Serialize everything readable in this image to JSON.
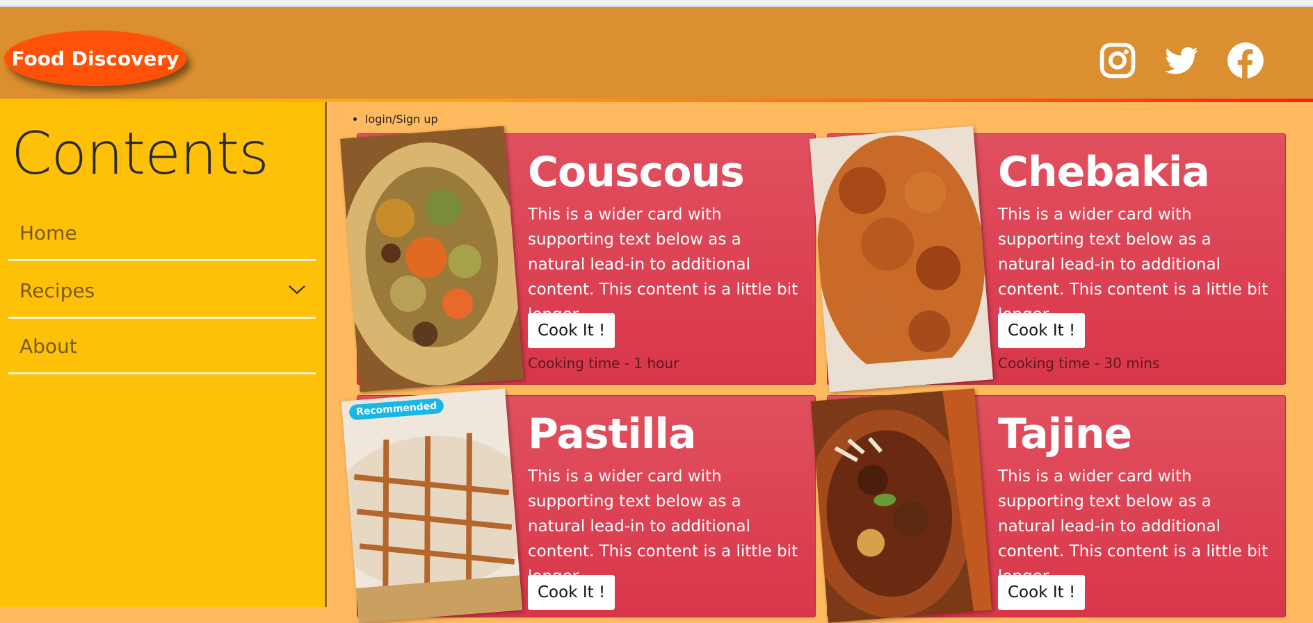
{
  "header": {
    "brand": "Food Discovery",
    "social": [
      "instagram-icon",
      "twitter-icon",
      "facebook-icon"
    ]
  },
  "sidebar": {
    "title": "Contents",
    "items": [
      {
        "label": "Home"
      },
      {
        "label": "Recipes",
        "has_dropdown": true
      },
      {
        "label": "About"
      }
    ]
  },
  "nav": {
    "login": "login/Sign up"
  },
  "cards": [
    {
      "title": "Couscous",
      "text": "This is a wider card with supporting text below as a natural lead-in to additional content. This content is a little bit longer.",
      "button": "Cook It !",
      "time": "Cooking time - 1 hour"
    },
    {
      "title": "Chebakia",
      "text": "This is a wider card with supporting text below as a natural lead-in to additional content. This content is a little bit longer.",
      "button": "Cook It !",
      "time": "Cooking time - 30 mins"
    },
    {
      "title": "Pastilla",
      "text": "This is a wider card with supporting text below as a natural lead-in to additional content. This content is a little bit longer.",
      "button": "Cook It !",
      "badge": "Recommended"
    },
    {
      "title": "Tajine",
      "text": "This is a wider card with supporting text below as a natural lead-in to additional content. This content is a little bit longer.",
      "button": "Cook It !"
    }
  ],
  "colors": {
    "header": "#db8f30",
    "sidebar": "#ffc107",
    "content_bg": "#ffb95e",
    "card": "#d9364a",
    "brand": "#ff5208",
    "badge": "#17b8e6"
  }
}
